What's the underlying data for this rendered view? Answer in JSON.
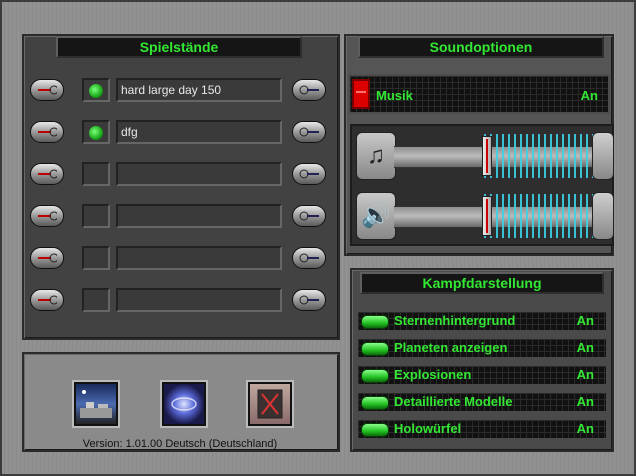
{
  "saves": {
    "title": "Spielstände",
    "slots": [
      {
        "name": "hard large day 150",
        "used": true
      },
      {
        "name": "dfg",
        "used": true
      },
      {
        "name": "",
        "used": false
      },
      {
        "name": "",
        "used": false
      },
      {
        "name": "",
        "used": false
      },
      {
        "name": "",
        "used": false
      }
    ]
  },
  "sound": {
    "title": "Soundoptionen",
    "music_label": "Musik",
    "music_value": "An",
    "music_volume": 0.45,
    "effects_volume": 0.45
  },
  "combat": {
    "title": "Kampfdarstellung",
    "options": [
      {
        "label": "Sternenhintergrund",
        "value": "An"
      },
      {
        "label": "Planeten anzeigen",
        "value": "An"
      },
      {
        "label": "Explosionen",
        "value": "An"
      },
      {
        "label": "Detaillierte Modelle",
        "value": "An"
      },
      {
        "label": "Holowürfel",
        "value": "An"
      }
    ]
  },
  "footer": {
    "version": "Version: 1.01.00 Deutsch (Deutschland)"
  },
  "colors": {
    "green_text": "#33e833",
    "slider_bars": "#3cd2e6",
    "music_toggle": "#dd0000"
  }
}
